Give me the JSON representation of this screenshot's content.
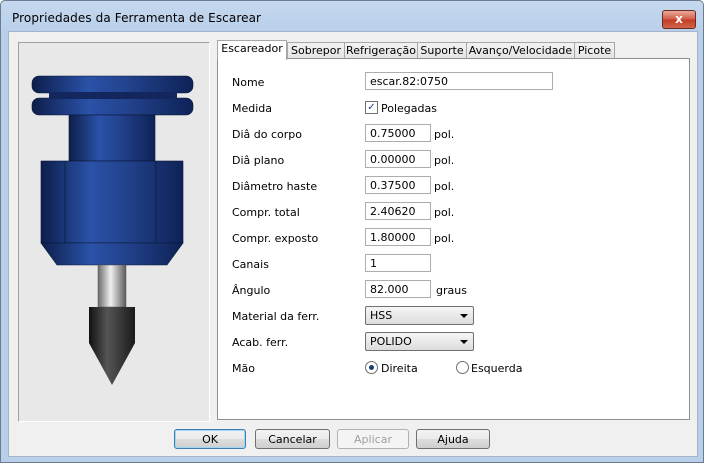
{
  "window": {
    "title": "Propriedades da Ferramenta de Escarear",
    "close_glyph": "x"
  },
  "tabs": [
    {
      "label": "Escareador",
      "active": true
    },
    {
      "label": "Sobrepor",
      "active": false
    },
    {
      "label": "Refrigeração",
      "active": false
    },
    {
      "label": "Suporte",
      "active": false
    },
    {
      "label": "Avanço/Velocidade",
      "active": false
    },
    {
      "label": "Picote",
      "active": false
    }
  ],
  "form": {
    "nome": {
      "label": "Nome",
      "value": "escar.82:0750"
    },
    "medida": {
      "label": "Medida",
      "checkbox_label": "Polegadas",
      "checked": true
    },
    "dia_corpo": {
      "label": "Diâ do corpo",
      "value": "0.75000",
      "unit": "pol."
    },
    "dia_plano": {
      "label": "Diâ plano",
      "value": "0.00000",
      "unit": "pol."
    },
    "diametro_haste": {
      "label": "Diâmetro haste",
      "value": "0.37500",
      "unit": "pol."
    },
    "compr_total": {
      "label": "Compr. total",
      "value": "2.40620",
      "unit": "pol."
    },
    "compr_exposto": {
      "label": "Compr. exposto",
      "value": "1.80000",
      "unit": "pol."
    },
    "canais": {
      "label": "Canais",
      "value": "1"
    },
    "angulo": {
      "label": "Ângulo",
      "value": "82.000",
      "unit": "graus"
    },
    "material": {
      "label": "Material da ferr.",
      "value": "HSS"
    },
    "acabamento": {
      "label": "Acab. ferr.",
      "value": "POLIDO"
    },
    "mao": {
      "label": "Mão",
      "options": [
        "Direita",
        "Esquerda"
      ],
      "selected": "Direita"
    }
  },
  "buttons": {
    "ok": "OK",
    "cancel": "Cancelar",
    "apply": "Aplicar",
    "help": "Ajuda"
  },
  "colors": {
    "tool_body": "#22428c",
    "tool_shank": "#c8c8c8",
    "tool_tip": "#3a3a3a"
  }
}
